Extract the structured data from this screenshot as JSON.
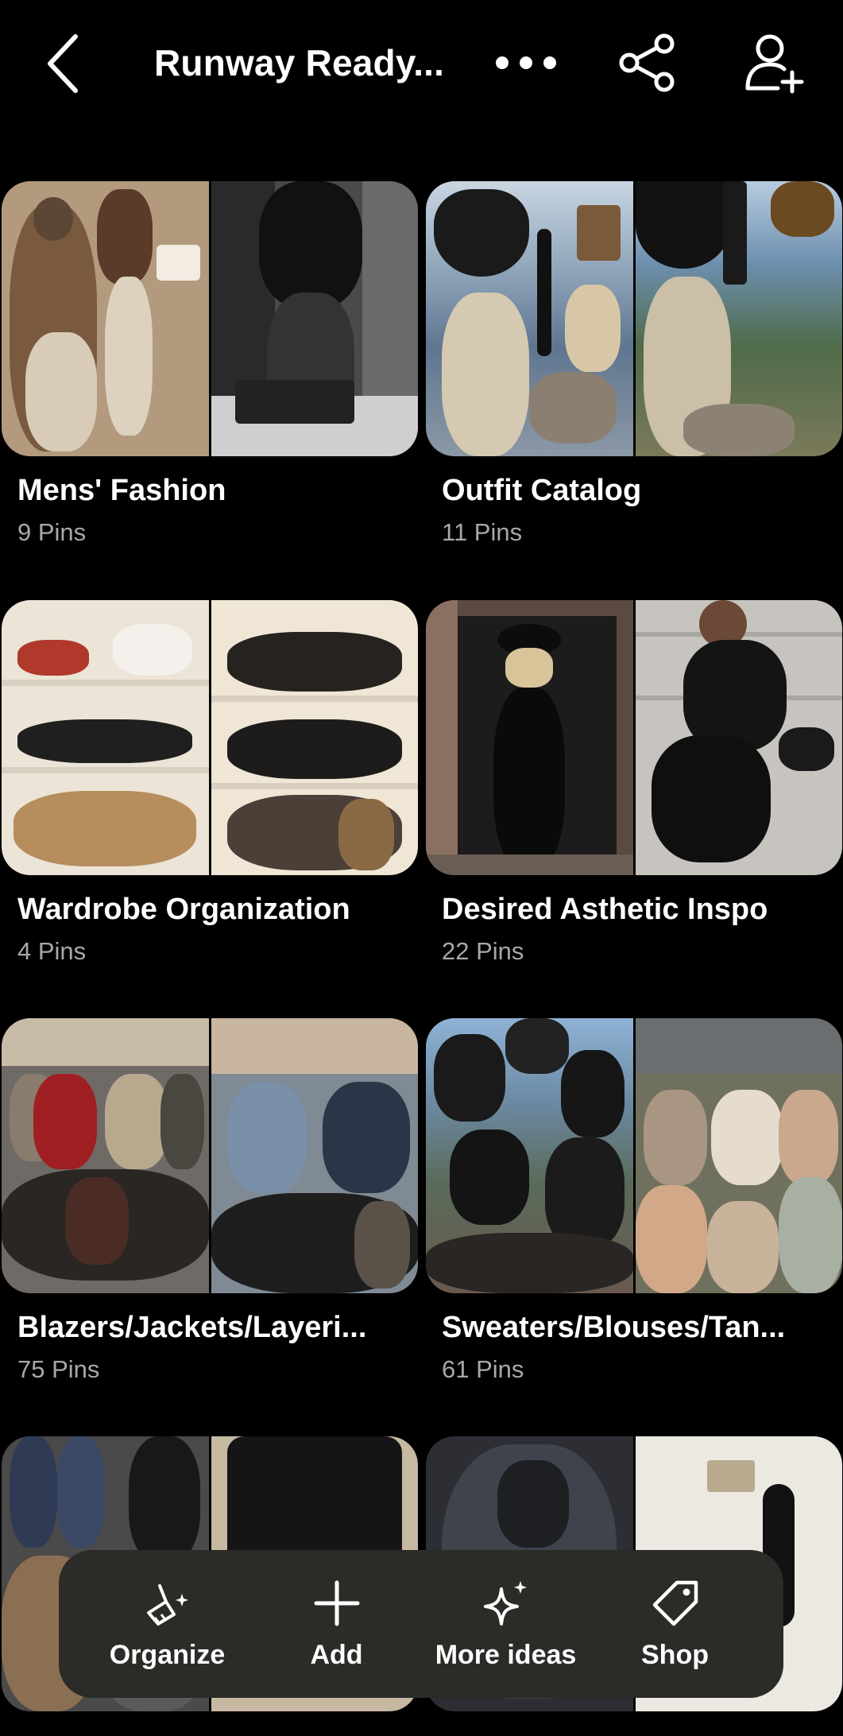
{
  "header": {
    "title": "Runway Ready...",
    "back_icon": "chevron-left-icon",
    "more_icon": "ellipsis-icon",
    "share_icon": "share-icon",
    "invite_icon": "add-collaborator-icon"
  },
  "boards": [
    {
      "name": "Mens' Fashion",
      "count": "9 Pins"
    },
    {
      "name": "Outfit Catalog",
      "count": "11 Pins"
    },
    {
      "name": "Wardrobe Organization",
      "count": "4 Pins"
    },
    {
      "name": "Desired Asthetic Inspo",
      "count": "22 Pins"
    },
    {
      "name": "Blazers/Jackets/Layeri...",
      "count": "75 Pins"
    },
    {
      "name": "Sweaters/Blouses/Tan...",
      "count": "61 Pins"
    }
  ],
  "toolbar": {
    "organize_label": "Organize",
    "add_label": "Add",
    "more_ideas_label": "More ideas",
    "shop_label": "Shop"
  },
  "colors": {
    "background": "#000000",
    "toolbar": "#2b2b28",
    "secondary_text": "#a8a8a8"
  }
}
